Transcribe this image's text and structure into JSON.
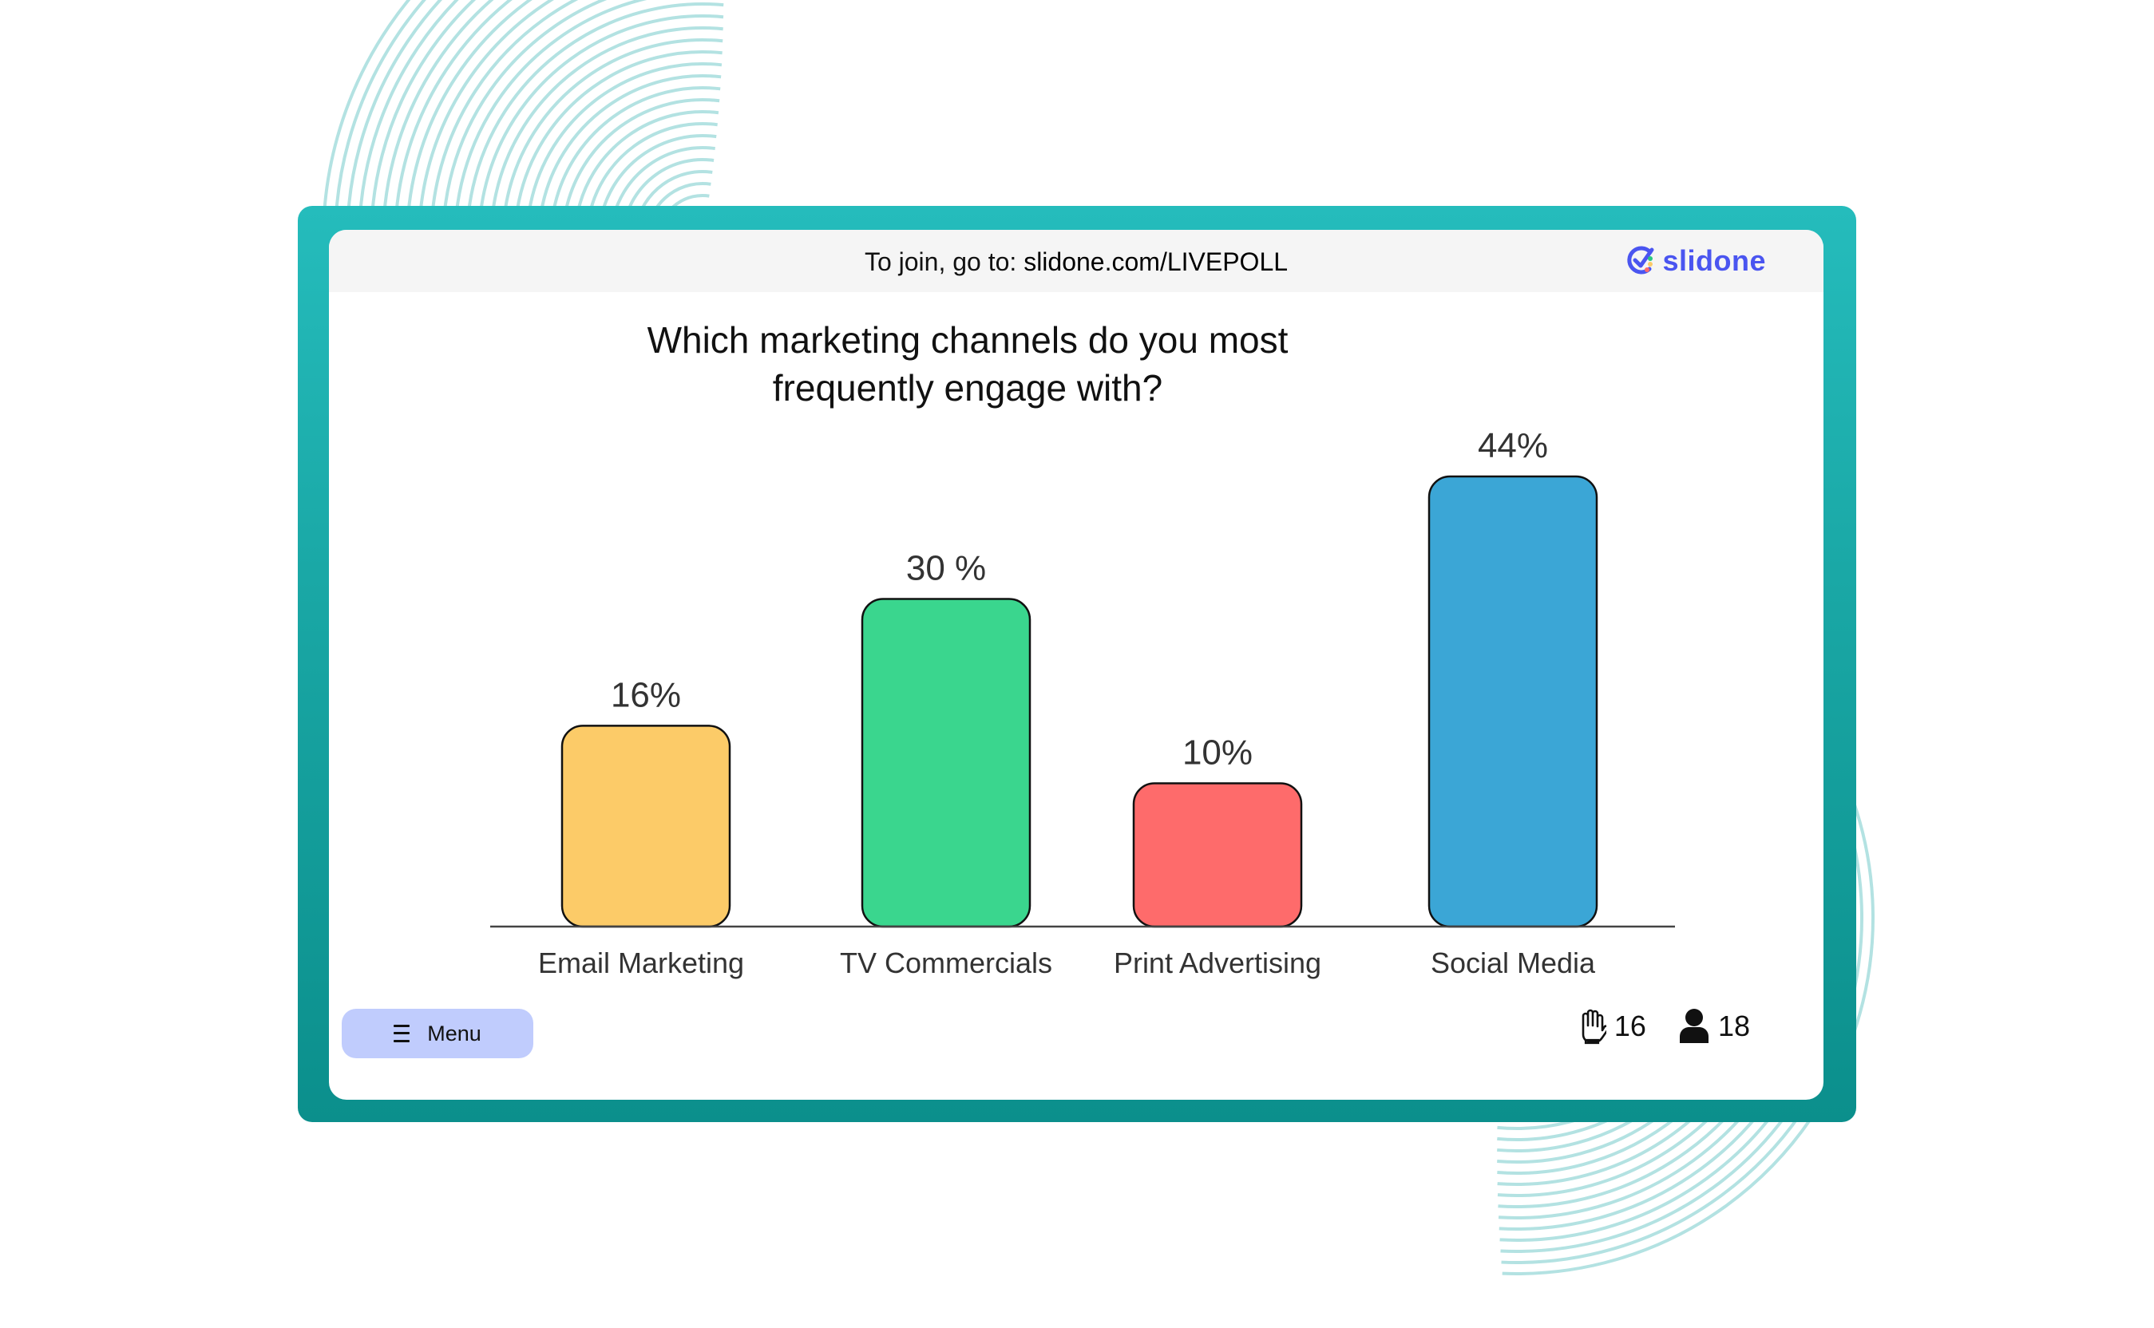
{
  "header": {
    "join_prefix": "To join, go to: ",
    "join_url": "slidone.com/LIVEPOLL",
    "brand": "slidone"
  },
  "colors": {
    "frame_top": "#25bcbc",
    "frame_bottom": "#0b8f8c",
    "brand": "#4a55f0",
    "menu_bg": "#c0ccfd",
    "swirl": "#b3e2e2"
  },
  "chart_data": {
    "type": "bar",
    "title": "Which marketing channels do you most frequently engage with?",
    "categories": [
      "Email Marketing",
      "TV Commercials",
      "Print Advertising",
      "Social Media"
    ],
    "values": [
      16,
      30,
      10,
      44
    ],
    "value_labels": [
      "16%",
      "30 %",
      "10%",
      "44%"
    ],
    "colors": [
      "#fccb68",
      "#3ad68e",
      "#fe6b6b",
      "#3ba6d6"
    ],
    "unit": "%",
    "xlabel": "",
    "ylabel": "",
    "ylim": [
      0,
      50
    ],
    "grid": false,
    "legend": "none"
  },
  "footer": {
    "menu_label": "Menu",
    "menu_icon": "hamburger-menu-icon",
    "raised_hands_count": "16",
    "raised_hands_icon": "hand-icon",
    "participants_count": "18",
    "participants_icon": "person-icon"
  }
}
